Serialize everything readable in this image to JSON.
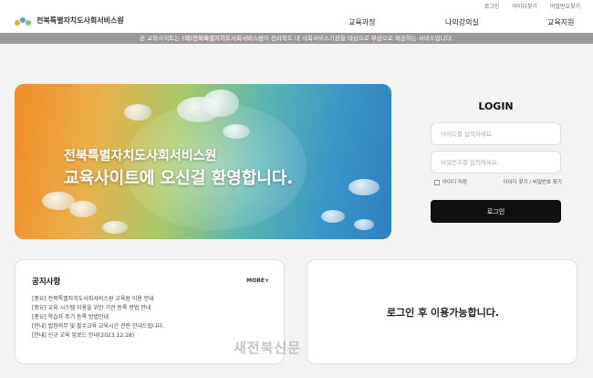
{
  "header": {
    "logo_text": "전북특별자치도사회서비스원",
    "util_links": [
      "로그인",
      "아이디찾기",
      "비밀번호찾기"
    ],
    "nav": [
      "교육과정",
      "나의강의실",
      "교육지원"
    ]
  },
  "notice_bar": {
    "prefix": "본 교육사이트는 ",
    "org": "(재)전북특별자치도사회서비스원",
    "middle": "이 전라북도 내 사회서비스기관을 대상으로 ",
    "free": "무상",
    "suffix": "으로 제공하는 서비스입니다."
  },
  "banner": {
    "line1": "전북특별자치도사회서비스원",
    "line2": "교육사이트에 오신걸 환영합니다."
  },
  "login": {
    "title": "LOGIN",
    "id_placeholder": "아이디를 입력하세요.",
    "pw_placeholder": "비밀번호를 입력하세요.",
    "save_id": "아이디 저장",
    "find_links": "아이디 찾기 / 비밀번호 찾기",
    "button": "로그인"
  },
  "notice_card": {
    "title": "공지사항",
    "more": "MORE+",
    "items": [
      "[중요] 전북특별자치도사회서비스원 교육원 이용 안내",
      "[중요] 교육 시스템 이용을 위한 기관 등록 방법 안내",
      "[중요] 학습자 주기 등록 방법안내",
      "[안내] 법정의무 및 필수교육 교육시간 관련 안내드립니다.",
      "[안내] 신규 교육 업로드 안내(2023.12.18)"
    ]
  },
  "login_required_card": {
    "message": "로그인 후 이용가능합니다."
  },
  "watermark": "새전북신문",
  "colors": {
    "notice_bar_bg": "#9a9a9a",
    "login_button_bg": "#111111",
    "logo_dots": [
      "#f2a33a",
      "#5aa0d8",
      "#7cc36a"
    ]
  }
}
